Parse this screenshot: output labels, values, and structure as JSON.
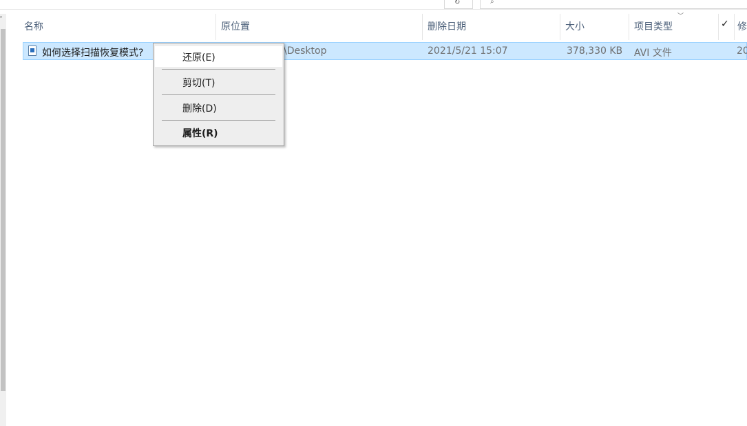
{
  "columns": {
    "name": "名称",
    "original_location": "原位置",
    "date_deleted": "删除日期",
    "size": "大小",
    "item_type": "项目类型",
    "modified": "修"
  },
  "rows": [
    {
      "name": "如何选择扫描恢复模式?",
      "original_location": "\\Desktop",
      "date_deleted": "2021/5/21 15:07",
      "size": "378,330 KB",
      "item_type": "AVI 文件",
      "modified": "20"
    }
  ],
  "context_menu": {
    "restore": "还原(E)",
    "cut": "剪切(T)",
    "delete": "删除(D)",
    "properties": "属性(R)"
  },
  "icons": {
    "sort": "chevron-down-icon",
    "column_picker": "checkmark-icon",
    "file": "video-file-icon",
    "refresh": "refresh-icon",
    "search": "search-icon"
  },
  "colors": {
    "selection_bg": "#cce8ff",
    "selection_border": "#99d1ff",
    "header_text": "#4c607a",
    "menu_bg": "#eeeeee"
  }
}
